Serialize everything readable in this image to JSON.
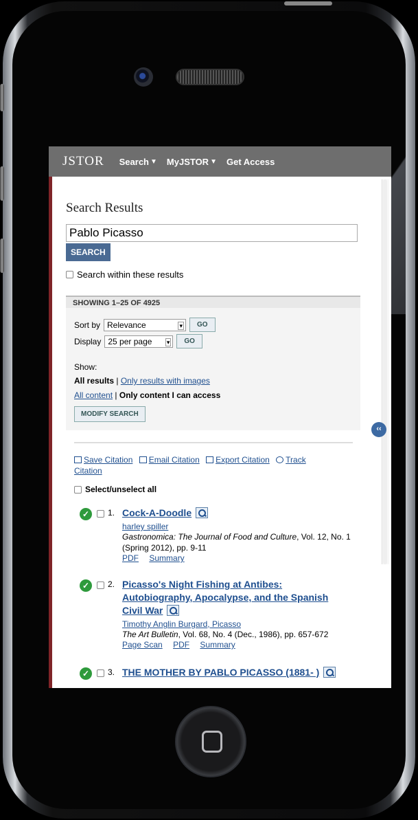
{
  "nav": {
    "logo": "JSTOR",
    "items": [
      {
        "label": "Search",
        "caret": "▼"
      },
      {
        "label": "MyJSTOR",
        "caret": "▼"
      },
      {
        "label": "Get Access",
        "caret": ""
      }
    ]
  },
  "page": {
    "title": "Search Results",
    "search_value": "Pablo Picasso",
    "search_button": "SEARCH",
    "within_label": "Search within these results"
  },
  "results_header": {
    "showing": "SHOWING 1–25 OF 4925",
    "sort_label": "Sort by",
    "sort_value": "Relevance",
    "display_label": "Display",
    "display_value": "25 per page",
    "go_label": "GO",
    "show_label": "Show:",
    "all_results": "All results",
    "only_images": "Only results with images",
    "all_content": "All content",
    "only_access": "Only content I can access",
    "modify": "MODIFY SEARCH",
    "separator": "|"
  },
  "tools": {
    "save": "Save Citation",
    "email": "Email Citation",
    "export": "Export Citation",
    "track": "Track",
    "track2": "Citation",
    "select_all": "Select/unselect all"
  },
  "results": [
    {
      "num": "1.",
      "title": "Cock-A-Doodle",
      "authors": "harley spiller",
      "journal_italic": "Gastronomica: The Journal of Food and Culture",
      "journal_rest": ", Vol. 12, No. 1 (Spring 2012), pp. 9-11",
      "links": [
        "PDF",
        "Summary"
      ]
    },
    {
      "num": "2.",
      "title": "Picasso's Night Fishing at Antibes: Autobiography, Apocalypse, and the Spanish Civil War",
      "authors": "Timothy Anglin Burgard",
      "authors2": "Picasso",
      "journal_italic": "The Art Bulletin",
      "journal_rest": ", Vol. 68, No. 4 (Dec., 1986), pp. 657-672",
      "links": [
        "Page Scan",
        "PDF",
        "Summary"
      ]
    },
    {
      "num": "3.",
      "title": "THE MOTHER BY PABLO PICASSO (1881- )"
    }
  ],
  "collapse_label": "‹‹",
  "check_glyph": "✓",
  "colors": {
    "nav_bg": "#6e6e6e",
    "accent_bar": "#7f2428",
    "link": "#1f4f8f",
    "search_button": "#4a6a93",
    "access_check": "#2e9a3c"
  }
}
